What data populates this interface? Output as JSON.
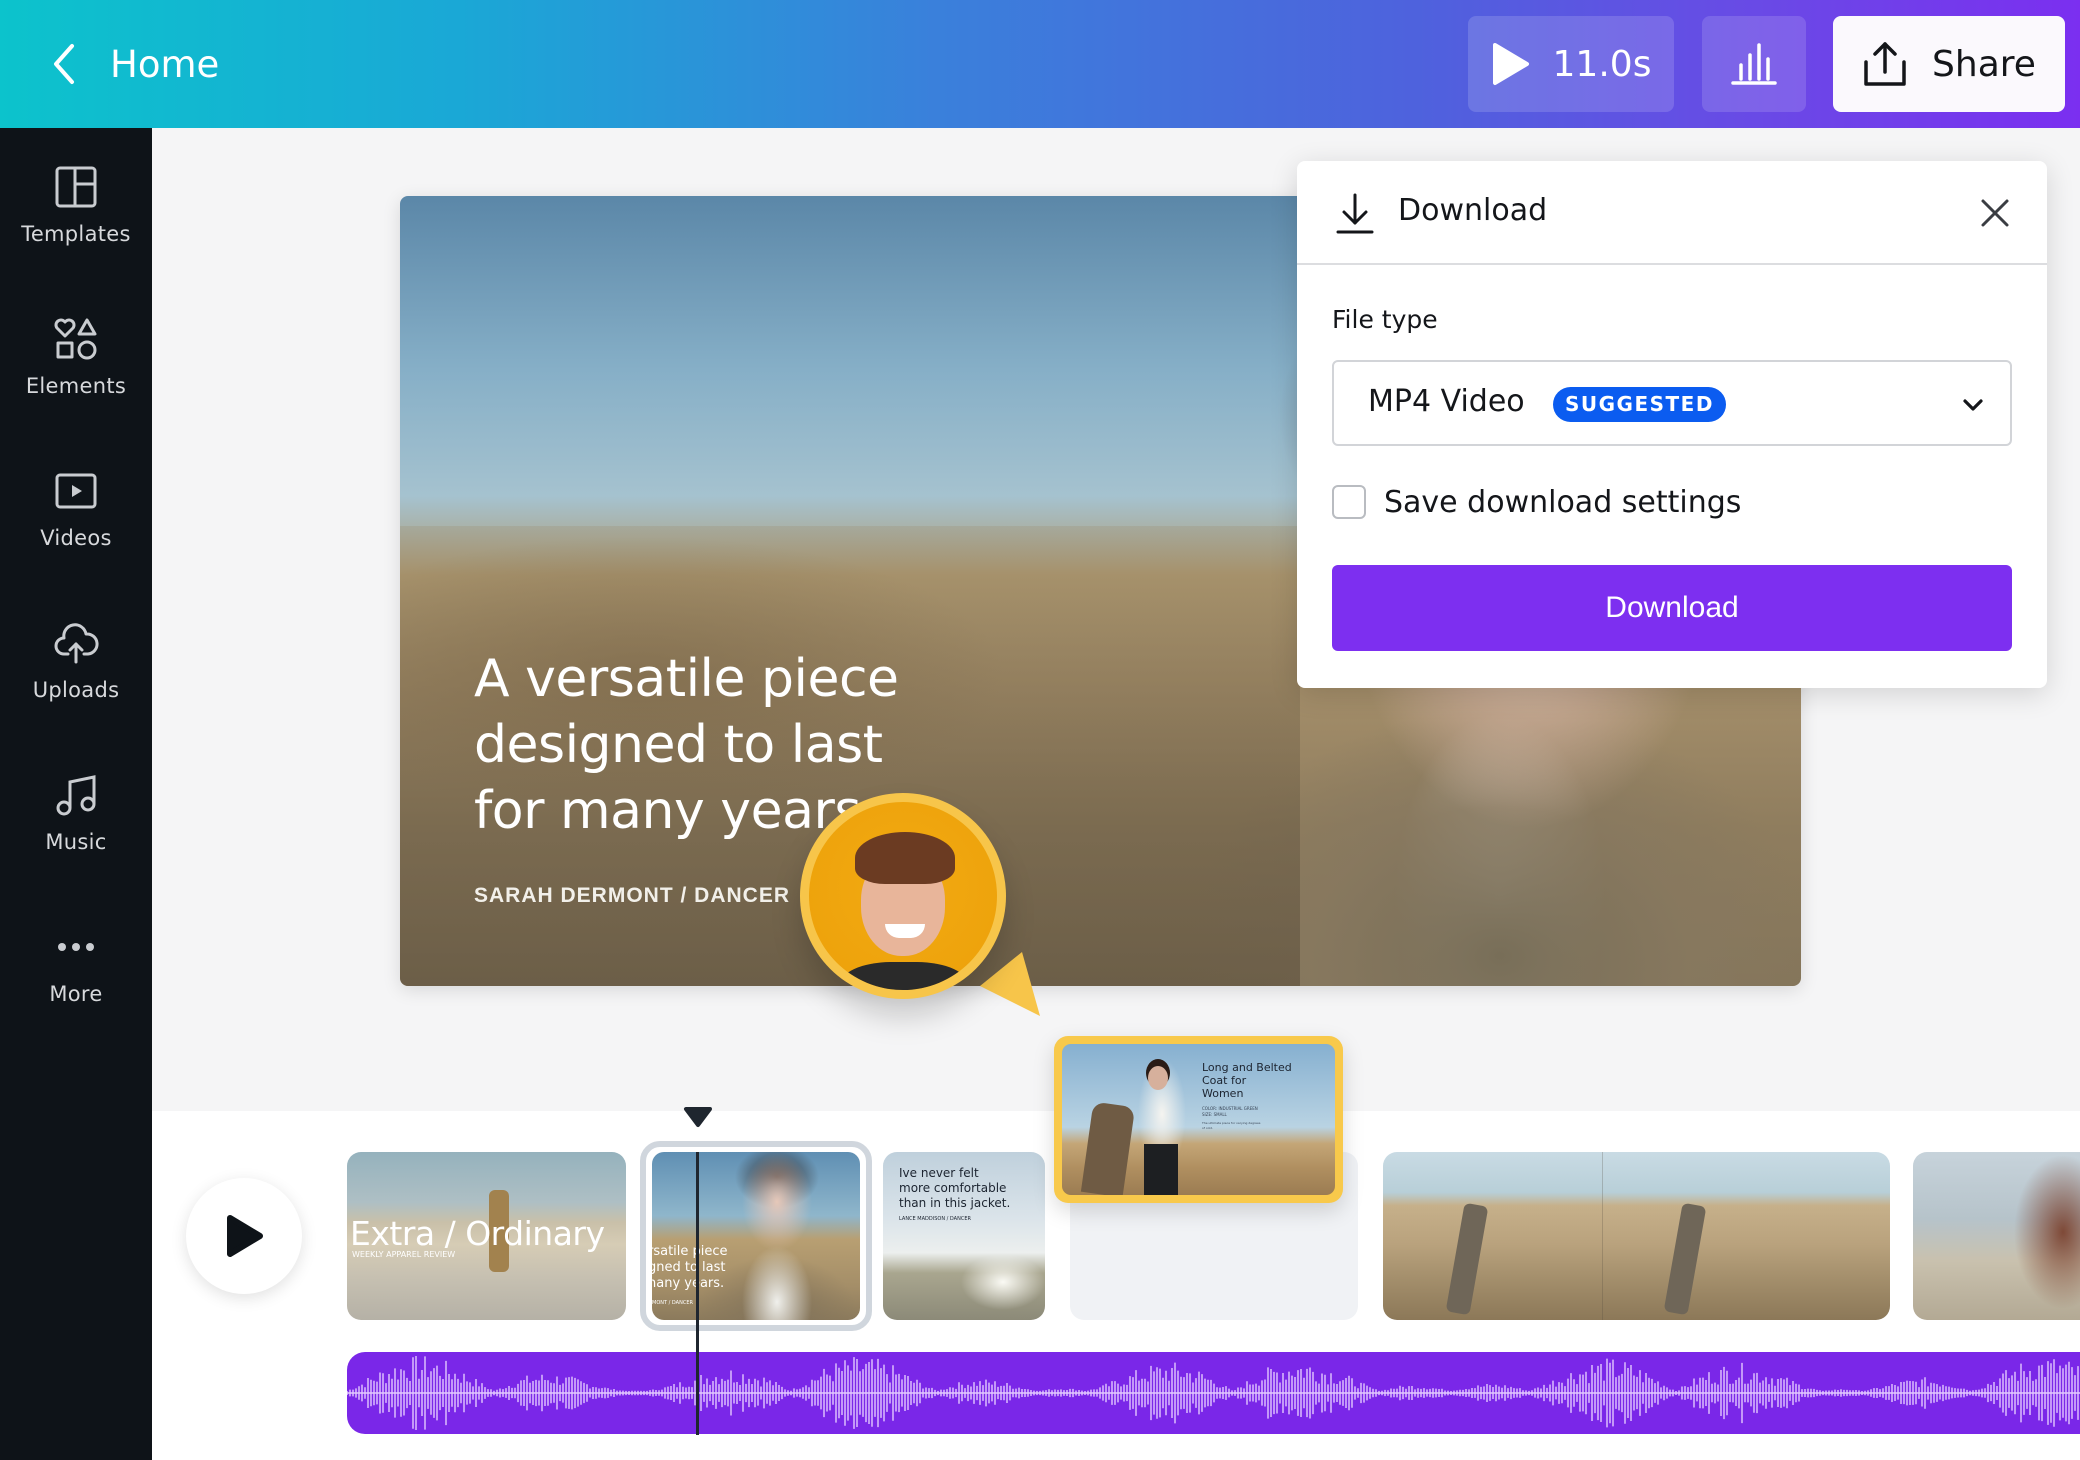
{
  "header": {
    "back_label": "Home",
    "play_duration": "11.0s",
    "share_label": "Share",
    "icons": {
      "back": "chevron-left-icon",
      "play": "play-icon",
      "stats": "bar-chart-icon",
      "share": "share-upload-icon"
    }
  },
  "sidebar": {
    "items": [
      {
        "label": "Templates",
        "icon": "templates-icon"
      },
      {
        "label": "Elements",
        "icon": "elements-icon"
      },
      {
        "label": "Videos",
        "icon": "video-icon"
      },
      {
        "label": "Uploads",
        "icon": "cloud-upload-icon"
      },
      {
        "label": "Music",
        "icon": "music-note-icon"
      },
      {
        "label": "More",
        "icon": "more-dots-icon"
      }
    ]
  },
  "canvas": {
    "title_lines": [
      "A versatile piece",
      "designed to last",
      "for many years."
    ],
    "byline": "SARAH DERMONT / DANCER"
  },
  "download_panel": {
    "title": "Download",
    "file_type_label": "File type",
    "file_type_value": "MP4 Video",
    "badge": "SUGGESTED",
    "save_settings_label": "Save download settings",
    "save_settings_checked": false,
    "button_label": "Download",
    "colors": {
      "button": "#7d2ff0",
      "badge": "#0b5cf0"
    }
  },
  "timeline": {
    "thumbs": [
      {
        "title": "Extra / Ordinary",
        "subtitle": "WEEKLY APPAREL REVIEW"
      },
      {
        "title_lines": [
          "rsatile piece",
          "gned to last",
          "nany years."
        ],
        "subtitle": "MONT / DANCER",
        "selected": true
      },
      {
        "title_lines": [
          "Ive never felt",
          "more comfortable",
          "than in this jacket."
        ],
        "subtitle": "LANCE MADDISON / DANCER"
      },
      {
        "empty": true
      },
      {
        "description": "desert dunes clip"
      },
      {
        "description": "portrait clip"
      }
    ],
    "dragging_thumb": {
      "title_lines": [
        "Long and Belted",
        "Coat for",
        "Women"
      ],
      "details": [
        "COLOR: INDUSTRIAL GREEN",
        "SIZE: SMALL"
      ],
      "note": "The ultimate piece for varying degrees of cold."
    },
    "audio_track": {
      "color": "#7a27e8",
      "wave_color": "#e3c9ff"
    }
  }
}
